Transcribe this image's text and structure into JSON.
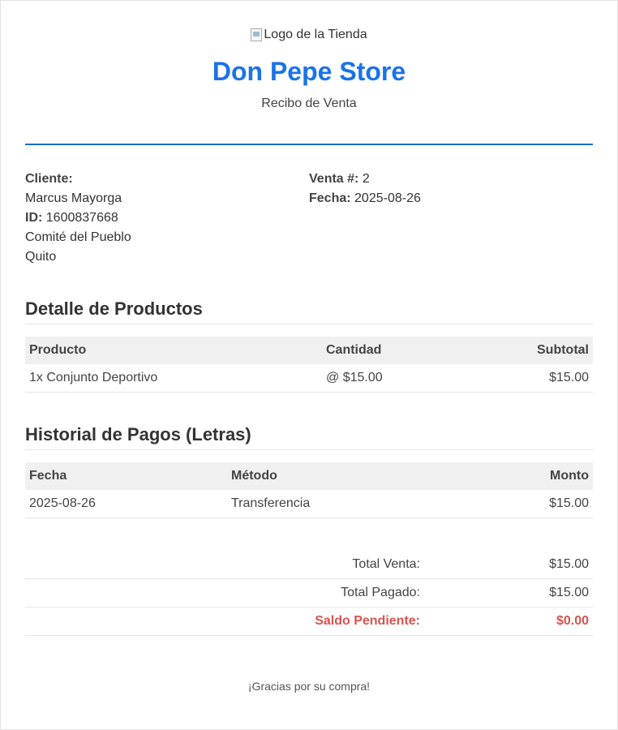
{
  "header": {
    "logo_alt": "Logo de la Tienda",
    "store_name": "Don Pepe Store",
    "subtitle": "Recibo de Venta"
  },
  "customer": {
    "label": "Cliente:",
    "name": "Marcus Mayorga",
    "id_label": "ID:",
    "id_value": "1600837668",
    "address_line1": "Comité del Pueblo",
    "address_line2": "Quito"
  },
  "sale": {
    "number_label": "Venta #:",
    "number_value": "2",
    "date_label": "Fecha:",
    "date_value": "2025-08-26"
  },
  "products": {
    "title": "Detalle de Productos",
    "columns": [
      "Producto",
      "Cantidad",
      "Subtotal"
    ],
    "rows": [
      {
        "product": "1x Conjunto Deportivo",
        "quantity": "@ $15.00",
        "subtotal": "$15.00"
      }
    ]
  },
  "payments": {
    "title": "Historial de Pagos (Letras)",
    "columns": [
      "Fecha",
      "Método",
      "Monto"
    ],
    "rows": [
      {
        "date": "2025-08-26",
        "method": "Transferencia",
        "amount": "$15.00"
      }
    ]
  },
  "totals": {
    "total_sale_label": "Total Venta:",
    "total_sale_value": "$15.00",
    "total_paid_label": "Total Pagado:",
    "total_paid_value": "$15.00",
    "pending_label": "Saldo Pendiente:",
    "pending_value": "$0.00"
  },
  "footer": {
    "thanks": "¡Gracias por su compra!"
  },
  "colors": {
    "brand": "#1a73e8",
    "pending": "#d9534f"
  }
}
